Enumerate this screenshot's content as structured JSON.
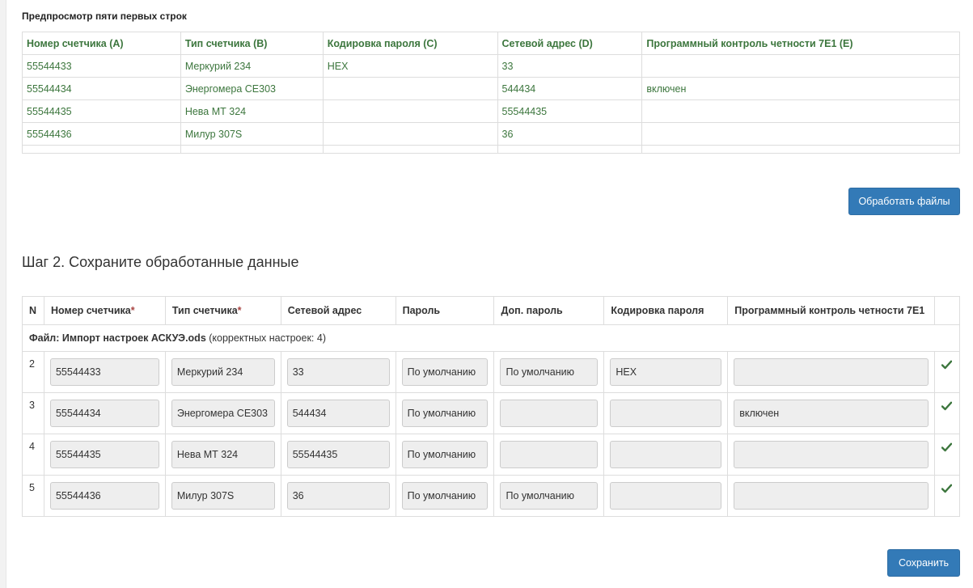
{
  "preview": {
    "title": "Предпросмотр пяти первых строк",
    "headers": [
      "Номер счетчика (A)",
      "Тип счетчика (B)",
      "Кодировка пароля (C)",
      "Сетевой адрес (D)",
      "Программный контроль четности 7E1 (E)"
    ],
    "rows": [
      [
        "55544433",
        "Меркурий 234",
        "HEX",
        "33",
        ""
      ],
      [
        "55544434",
        "Энергомера CE303",
        "",
        "544434",
        "включен"
      ],
      [
        "55544435",
        "Нева МТ 324",
        "",
        "55544435",
        ""
      ],
      [
        "55544436",
        "Милур 307S",
        "",
        "36",
        ""
      ]
    ]
  },
  "process_button": "Обработать файлы",
  "step2": {
    "title": "Шаг 2. Сохраните обработанные данные",
    "headers": {
      "n": "N",
      "meter_number": "Номер счетчика",
      "meter_type": "Тип счетчика",
      "required_mark": "*",
      "network_address": "Сетевой адрес",
      "password": "Пароль",
      "extra_password": "Доп. пароль",
      "password_encoding": "Кодировка пароля",
      "parity": "Программный контроль четности 7E1"
    },
    "file": {
      "prefix": "Файл: Импорт настроек АСКУЭ.ods",
      "note": " (корректных настроек: 4)"
    },
    "rows": [
      {
        "n": "2",
        "meter_number": "55544433",
        "meter_type": "Меркурий 234",
        "network_address": "33",
        "password": "По умолчанию",
        "extra_password": "По умолчанию",
        "password_encoding": "HEX",
        "parity": ""
      },
      {
        "n": "3",
        "meter_number": "55544434",
        "meter_type": "Энергомера CE303",
        "network_address": "544434",
        "password": "По умолчанию",
        "extra_password": "",
        "password_encoding": "",
        "parity": "включен"
      },
      {
        "n": "4",
        "meter_number": "55544435",
        "meter_type": "Нева МТ 324",
        "network_address": "55544435",
        "password": "По умолчанию",
        "extra_password": "",
        "password_encoding": "",
        "parity": ""
      },
      {
        "n": "5",
        "meter_number": "55544436",
        "meter_type": "Милур 307S",
        "network_address": "36",
        "password": "По умолчанию",
        "extra_password": "По умолчанию",
        "password_encoding": "",
        "parity": ""
      }
    ],
    "row_status_icon": "check-icon"
  },
  "save_button": "Сохранить",
  "colors": {
    "preview_text": "#3c763d",
    "primary_button": "#337ab7",
    "required_mark": "#a94442",
    "check_icon": "#3c763d",
    "input_bg": "#eeeeee"
  }
}
